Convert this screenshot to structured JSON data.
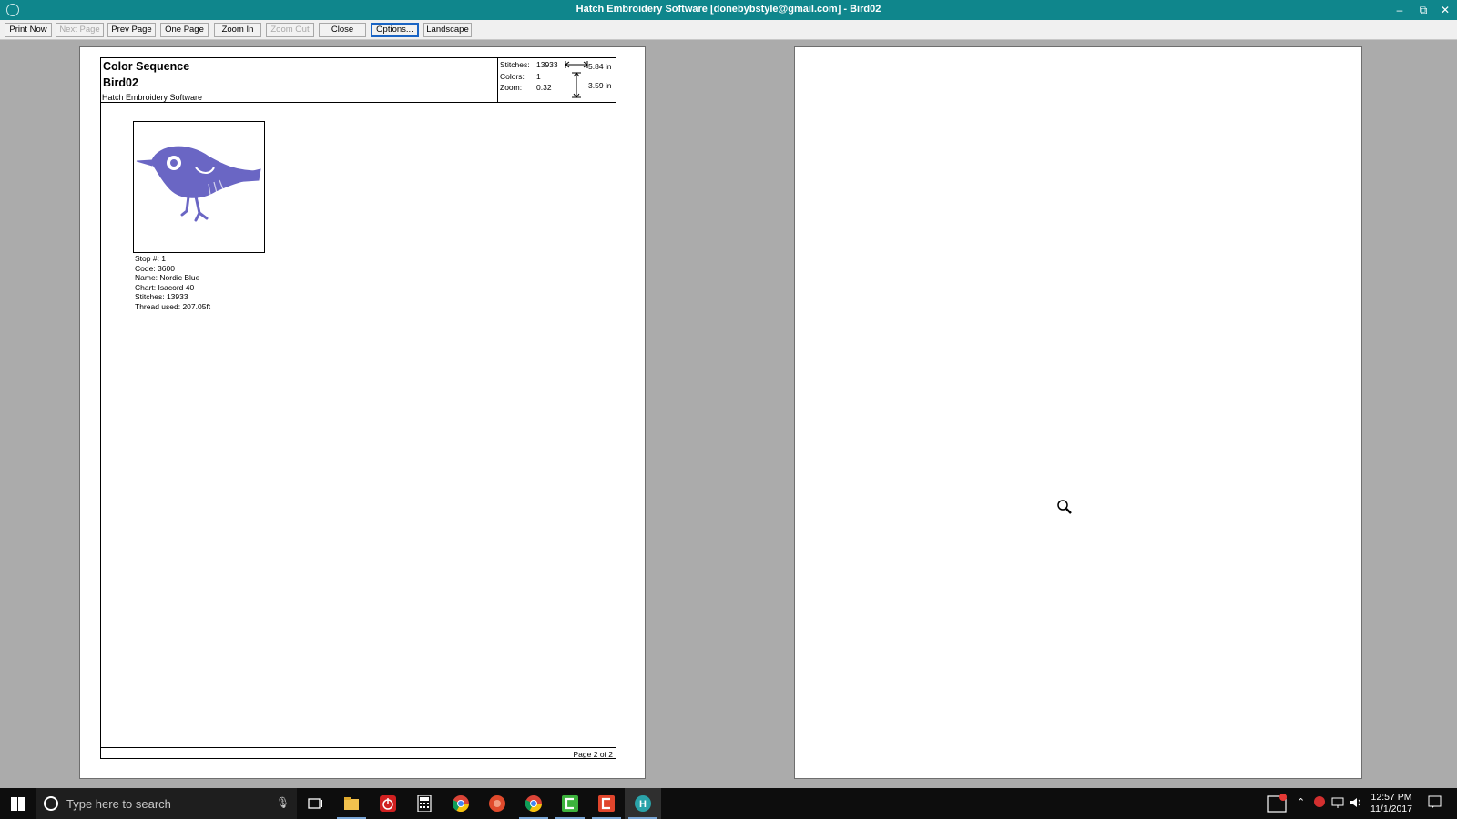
{
  "window": {
    "title": "Hatch Embroidery Software [donebybstyle@gmail.com] - Bird02",
    "controls": {
      "minimize": "–",
      "restore": "⧉",
      "close": "✕"
    }
  },
  "toolbar": {
    "print_now": "Print Now",
    "next_page": "Next Page",
    "prev_page": "Prev Page",
    "one_page": "One Page",
    "zoom_in": "Zoom In",
    "zoom_out": "Zoom Out",
    "close": "Close",
    "options": "Options...",
    "landscape": "Landscape"
  },
  "sheet": {
    "title": "Color Sequence",
    "design": "Bird02",
    "company": "Hatch Embroidery Software",
    "stats": {
      "stitches_label": "Stitches:",
      "stitches_value": "13933",
      "colors_label": "Colors:",
      "colors_value": "1",
      "zoom_label": "Zoom:",
      "zoom_value": "0.32"
    },
    "width": "5.84 in",
    "height": "3.59 in",
    "color_info": {
      "stop": "Stop #: 1",
      "code": "Code: 3600",
      "name": "Name: Nordic Blue",
      "chart": "Chart: Isacord 40",
      "stitches": "Stitches: 13933",
      "thread": "Thread used: 207.05ft"
    },
    "footer": "Page 2 of 2",
    "thread_color": "#6a66c4"
  },
  "taskbar": {
    "search_placeholder": "Type here to search",
    "time": "12:57 PM",
    "date": "11/1/2017",
    "icons": [
      "windows-icon",
      "task-view-icon",
      "file-explorer-icon",
      "power-icon",
      "calculator-icon",
      "chrome-icon",
      "red-app-icon",
      "chrome-user-icon",
      "camtasia-icon",
      "red-c-icon",
      "hatch-icon"
    ]
  }
}
